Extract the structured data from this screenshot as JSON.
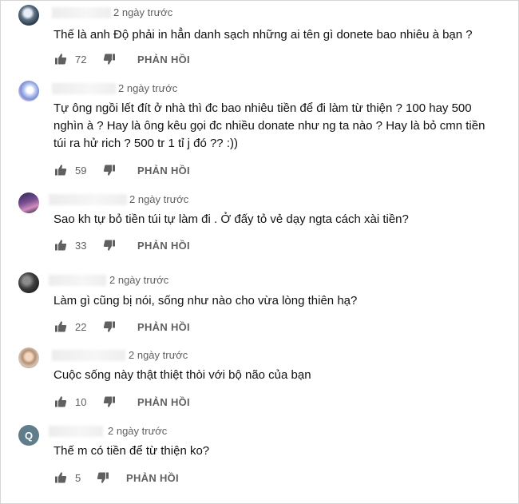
{
  "comments": [
    {
      "avatar": "profile-photo",
      "time": "2 ngày trước",
      "text": "Thế là anh Độ phải in hẳn danh sạch những ai tên gì donete bao nhiêu à bạn ?",
      "likes": "72",
      "reply_label": "PHẢN HỒI"
    },
    {
      "avatar": "profile-photo",
      "time": "2 ngày trước",
      "text": "Tự ông ngồi lết đít ở nhà thì đc bao nhiêu tiền để đi làm từ thiện ? 100 hay 500 nghìn à ? Hay là ông kêu gọi đc nhiều donate như ng ta nào ? Hay là bỏ cmn tiền túi ra hử rich ? 500 tr 1 tỉ j đó ?? :))",
      "likes": "59",
      "reply_label": "PHẢN HỒI"
    },
    {
      "avatar": "profile-photo",
      "time": "2 ngày trước",
      "text": "Sao kh tự bỏ tiền túi tự làm đi . Ở đấy tỏ vẻ dạy ngta cách xài tiền?",
      "likes": "33",
      "reply_label": "PHẢN HỒI"
    },
    {
      "avatar": "profile-photo",
      "time": "2 ngày trước",
      "text": "Làm gì cũng bị nói, sống như nào cho vừa lòng thiên hạ?",
      "likes": "22",
      "reply_label": "PHẢN HỒI"
    },
    {
      "avatar": "profile-photo",
      "time": "2 ngày trước",
      "text": "Cuộc sống này thật thiệt thòi với bộ não của bạn",
      "likes": "10",
      "reply_label": "PHẢN HỒI"
    },
    {
      "avatar": "letter-avatar",
      "avatar_letter": "Q",
      "time": "2 ngày trước",
      "text": "Thế m có tiền để từ thiện ko?",
      "likes": "5",
      "reply_label": "PHẢN HỒI"
    }
  ],
  "icons": {
    "like": "thumbs-up-icon",
    "dislike": "thumbs-down-icon"
  },
  "colors": {
    "text": "#111111",
    "meta": "#606060",
    "icon": "#606060",
    "letter_avatar": "#607d8b"
  }
}
